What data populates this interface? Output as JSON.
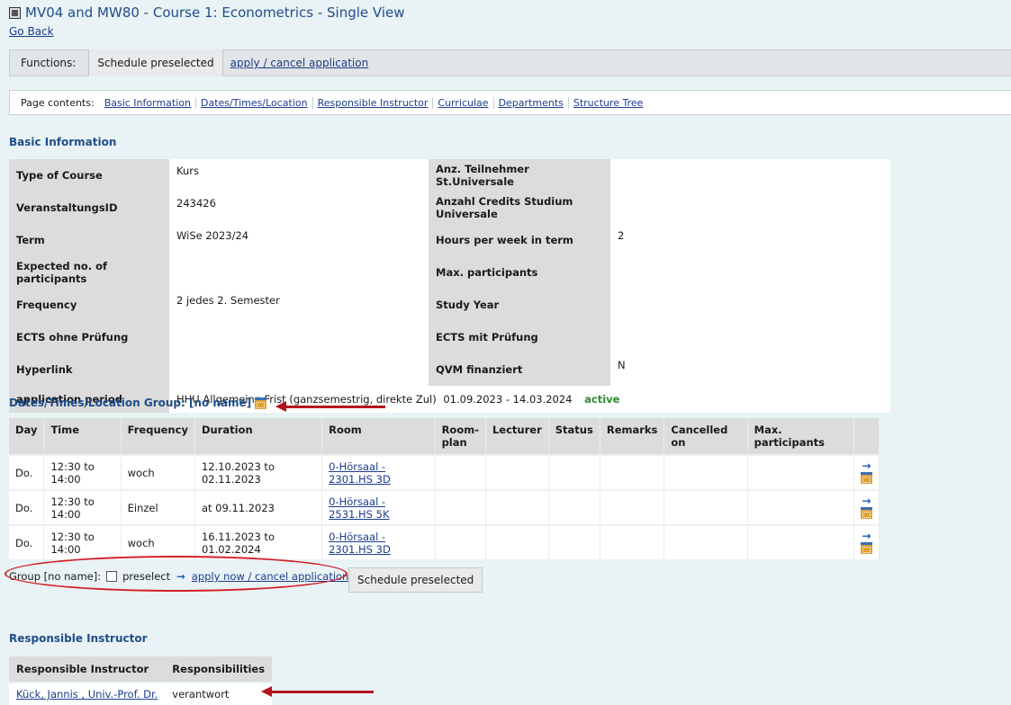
{
  "header": {
    "title": "MV04 and MW80 - Course 1: Econometrics - Single View",
    "go_back": "Go Back"
  },
  "functions": {
    "label": "Functions:",
    "schedule_button": "Schedule preselected",
    "apply_link": "apply / cancel application"
  },
  "page_contents": {
    "label": "Page contents:",
    "links": [
      "Basic Information",
      "Dates/Times/Location",
      "Responsible Instructor",
      "Curriculae",
      "Departments",
      "Structure Tree"
    ]
  },
  "basic_info": {
    "heading": "Basic Information",
    "rows": [
      {
        "k1": "Type of Course",
        "v1": "Kurs",
        "k2": "Anz. Teilnehmer St.Universale",
        "v2": ""
      },
      {
        "k1": "VeranstaltungsID",
        "v1": "243426",
        "k2": "Anzahl Credits Studium Universale",
        "v2": ""
      },
      {
        "k1": "Term",
        "v1": "WiSe 2023/24",
        "k2": "Hours per week in term",
        "v2": "2"
      },
      {
        "k1": "Expected no. of participants",
        "v1": "",
        "k2": "Max. participants",
        "v2": ""
      },
      {
        "k1": "Frequency",
        "v1": "2 jedes 2. Semester",
        "k2": "Study Year",
        "v2": ""
      },
      {
        "k1": "ECTS ohne Prüfung",
        "v1": "",
        "k2": "ECTS mit Prüfung",
        "v2": ""
      },
      {
        "k1": "Hyperlink",
        "v1": "",
        "k2": "QVM finanziert",
        "v2": "N"
      }
    ],
    "application_period": {
      "label": "application period",
      "value": "HHU Allgemeine Frist (ganzsemestrig, direkte Zul)",
      "dates": "01.09.2023 - 14.03.2024",
      "status": "active",
      "status_color": "#2e8b2e"
    }
  },
  "dates": {
    "heading": "Dates/Times/Location Group: [no name]",
    "columns": [
      "Day",
      "Time",
      "Frequency",
      "Duration",
      "Room",
      "Room-plan",
      "Lecturer",
      "Status",
      "Remarks",
      "Cancelled on",
      "Max. participants"
    ],
    "rows": [
      {
        "day": "Do.",
        "time": "12:30 to 14:00",
        "freq": "woch",
        "duration": "12.10.2023 to 02.11.2023",
        "room": "0-Hörsaal - 2301.HS 3D"
      },
      {
        "day": "Do.",
        "time": "12:30 to 14:00",
        "freq": "Einzel",
        "duration": "at 09.11.2023",
        "room": "0-Hörsaal - 2531.HS 5K"
      },
      {
        "day": "Do.",
        "time": "12:30 to 14:00",
        "freq": "woch",
        "duration": "16.11.2023 to 01.02.2024",
        "room": "0-Hörsaal - 2301.HS 3D"
      }
    ],
    "group_label": "Group [no name]:",
    "preselect": "preselect",
    "apply_link": "apply now / cancel application",
    "schedule_button": "Schedule preselected"
  },
  "instructor": {
    "heading": "Responsible Instructor",
    "columns": [
      "Responsible Instructor",
      "Responsibilities"
    ],
    "name": "Kück, Jannis , Univ.-Prof. Dr.",
    "role": "verantwort"
  },
  "annotation_color": "#b3141b"
}
